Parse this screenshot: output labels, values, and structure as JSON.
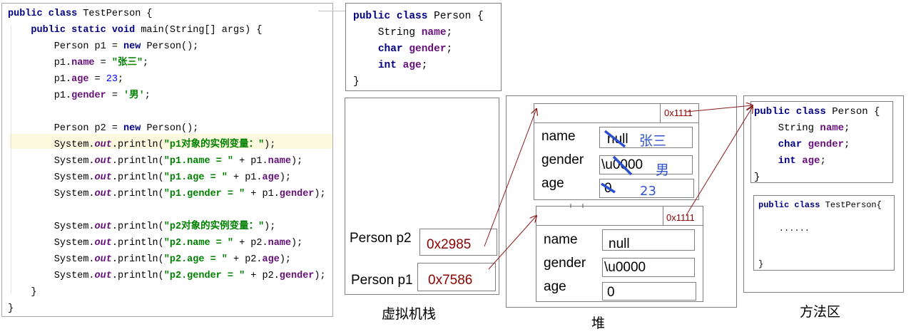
{
  "code_panel": {
    "lines": [
      [
        {
          "t": "public class",
          "c": "kw"
        },
        {
          "t": " TestPerson {",
          "c": ""
        }
      ],
      [
        {
          "t": "    ",
          "c": ""
        },
        {
          "t": "public static void",
          "c": "kw"
        },
        {
          "t": " main(String[] args) {",
          "c": ""
        }
      ],
      [
        {
          "t": "        Person p1 = ",
          "c": ""
        },
        {
          "t": "new",
          "c": "kw"
        },
        {
          "t": " Person();",
          "c": ""
        }
      ],
      [
        {
          "t": "        p1.",
          "c": ""
        },
        {
          "t": "name",
          "c": "fld"
        },
        {
          "t": " = ",
          "c": ""
        },
        {
          "t": "\"张三\"",
          "c": "str"
        },
        {
          "t": ";",
          "c": ""
        }
      ],
      [
        {
          "t": "        p1.",
          "c": ""
        },
        {
          "t": "age",
          "c": "fld"
        },
        {
          "t": " = ",
          "c": ""
        },
        {
          "t": "23",
          "c": "num"
        },
        {
          "t": ";",
          "c": ""
        }
      ],
      [
        {
          "t": "        p1.",
          "c": ""
        },
        {
          "t": "gender",
          "c": "fld"
        },
        {
          "t": " = ",
          "c": ""
        },
        {
          "t": "'男'",
          "c": "str"
        },
        {
          "t": ";",
          "c": ""
        }
      ],
      [],
      [
        {
          "t": "        Person p2 = ",
          "c": ""
        },
        {
          "t": "new",
          "c": "kw"
        },
        {
          "t": " Person();",
          "c": ""
        }
      ],
      [
        {
          "t": "        System.",
          "c": ""
        },
        {
          "t": "out",
          "c": "itl"
        },
        {
          "t": ".println(",
          "c": ""
        },
        {
          "t": "\"p1对象的实例变量：\"",
          "c": "str"
        },
        {
          "t": ");",
          "c": ""
        }
      ],
      [
        {
          "t": "        System.",
          "c": ""
        },
        {
          "t": "out",
          "c": "itl"
        },
        {
          "t": ".println(",
          "c": ""
        },
        {
          "t": "\"p1.name = \"",
          "c": "str"
        },
        {
          "t": " + p1.",
          "c": ""
        },
        {
          "t": "name",
          "c": "fld"
        },
        {
          "t": ");",
          "c": ""
        }
      ],
      [
        {
          "t": "        System.",
          "c": ""
        },
        {
          "t": "out",
          "c": "itl"
        },
        {
          "t": ".println(",
          "c": ""
        },
        {
          "t": "\"p1.age = \"",
          "c": "str"
        },
        {
          "t": " + p1.",
          "c": ""
        },
        {
          "t": "age",
          "c": "fld"
        },
        {
          "t": ");",
          "c": ""
        }
      ],
      [
        {
          "t": "        System.",
          "c": ""
        },
        {
          "t": "out",
          "c": "itl"
        },
        {
          "t": ".println(",
          "c": ""
        },
        {
          "t": "\"p1.gender = \"",
          "c": "str"
        },
        {
          "t": " + p1.",
          "c": ""
        },
        {
          "t": "gender",
          "c": "fld"
        },
        {
          "t": ");",
          "c": ""
        }
      ],
      [],
      [
        {
          "t": "        System.",
          "c": ""
        },
        {
          "t": "out",
          "c": "itl"
        },
        {
          "t": ".println(",
          "c": ""
        },
        {
          "t": "\"p2对象的实例变量：\"",
          "c": "str"
        },
        {
          "t": ");",
          "c": ""
        }
      ],
      [
        {
          "t": "        System.",
          "c": ""
        },
        {
          "t": "out",
          "c": "itl"
        },
        {
          "t": ".println(",
          "c": ""
        },
        {
          "t": "\"p2.name = \"",
          "c": "str"
        },
        {
          "t": " + p2.",
          "c": ""
        },
        {
          "t": "name",
          "c": "fld"
        },
        {
          "t": ");",
          "c": ""
        }
      ],
      [
        {
          "t": "        System.",
          "c": ""
        },
        {
          "t": "out",
          "c": "itl"
        },
        {
          "t": ".println(",
          "c": ""
        },
        {
          "t": "\"p2.age = \"",
          "c": "str"
        },
        {
          "t": " + p2.",
          "c": ""
        },
        {
          "t": "age",
          "c": "fld"
        },
        {
          "t": ");",
          "c": ""
        }
      ],
      [
        {
          "t": "        System.",
          "c": ""
        },
        {
          "t": "out",
          "c": "itl"
        },
        {
          "t": ".println(",
          "c": ""
        },
        {
          "t": "\"p2.gender = \"",
          "c": "str"
        },
        {
          "t": " + p2.",
          "c": ""
        },
        {
          "t": "gender",
          "c": "fld"
        },
        {
          "t": ");",
          "c": ""
        }
      ],
      [
        {
          "t": "    }",
          "c": ""
        }
      ],
      [
        {
          "t": "}",
          "c": ""
        }
      ]
    ]
  },
  "person_class": {
    "lines": [
      [
        {
          "t": "public class",
          "c": "kw"
        },
        {
          "t": " Person {",
          "c": ""
        }
      ],
      [
        {
          "t": "    String ",
          "c": ""
        },
        {
          "t": "name",
          "c": "fld"
        },
        {
          "t": ";",
          "c": ""
        }
      ],
      [
        {
          "t": "    ",
          "c": ""
        },
        {
          "t": "char",
          "c": "kw"
        },
        {
          "t": " ",
          "c": ""
        },
        {
          "t": "gender",
          "c": "fld"
        },
        {
          "t": ";",
          "c": ""
        }
      ],
      [
        {
          "t": "    ",
          "c": ""
        },
        {
          "t": "int",
          "c": "kw"
        },
        {
          "t": " ",
          "c": ""
        },
        {
          "t": "age",
          "c": "fld"
        },
        {
          "t": ";",
          "c": ""
        }
      ],
      [
        {
          "t": "}",
          "c": ""
        }
      ]
    ]
  },
  "stack": {
    "caption": "虚拟机栈",
    "p2_label": "Person p2",
    "p2_value": "0x2985",
    "p1_label": "Person p1",
    "p1_value": "0x7586"
  },
  "heap": {
    "caption": "堆",
    "obj1": {
      "class_ref": "0x1111",
      "name_label": "name",
      "name_old": "null",
      "name_new": "张三",
      "gender_label": "gender",
      "gender_old": "\\u0000",
      "gender_new": "男",
      "age_label": "age",
      "age_old": "0",
      "age_new": "23"
    },
    "obj2": {
      "class_ref": "0x1111",
      "name_label": "name",
      "name_value": "null",
      "gender_label": "gender",
      "gender_value": "\\u0000",
      "age_label": "age",
      "age_value": "0"
    }
  },
  "method_area": {
    "caption": "方法区",
    "person_lines": [
      [
        {
          "t": "public class",
          "c": "kw"
        },
        {
          "t": " Person {",
          "c": ""
        }
      ],
      [
        {
          "t": "    String ",
          "c": ""
        },
        {
          "t": "name",
          "c": "fld"
        },
        {
          "t": ";",
          "c": ""
        }
      ],
      [
        {
          "t": "    ",
          "c": ""
        },
        {
          "t": "char",
          "c": "kw"
        },
        {
          "t": " ",
          "c": ""
        },
        {
          "t": "gender",
          "c": "fld"
        },
        {
          "t": ";",
          "c": ""
        }
      ],
      [
        {
          "t": "    ",
          "c": ""
        },
        {
          "t": "int",
          "c": "kw"
        },
        {
          "t": " ",
          "c": ""
        },
        {
          "t": "age",
          "c": "fld"
        },
        {
          "t": ";",
          "c": ""
        }
      ],
      [
        {
          "t": "}",
          "c": ""
        }
      ]
    ],
    "testperson_lines": [
      [
        {
          "t": "public class",
          "c": "kw"
        },
        {
          "t": " TestPerson{",
          "c": ""
        }
      ],
      [],
      [
        {
          "t": "    ......",
          "c": ""
        }
      ],
      [],
      [],
      [
        {
          "t": "}",
          "c": ""
        }
      ]
    ]
  },
  "colors": {
    "arrow": "#8b1a1a",
    "keyword": "#000080",
    "field": "#660e7a",
    "string": "#008000",
    "annotation": "#3355cc"
  }
}
